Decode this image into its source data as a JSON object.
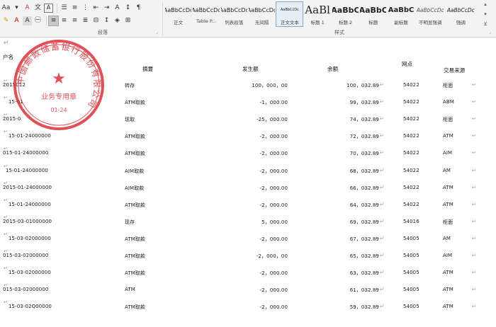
{
  "ribbon": {
    "paragraph_group_label": "段落",
    "styles_group_label": "样式",
    "styles": [
      {
        "preview": "AaBbCcDc",
        "name": "正文"
      },
      {
        "preview": "AaBbCcDc",
        "name": "Table P..."
      },
      {
        "preview": "AaBbCcDc",
        "name": "列表段落"
      },
      {
        "preview": "AaBbCcDc",
        "name": "无间隔"
      },
      {
        "preview": "AaBbCcDc",
        "name": "正文文本"
      },
      {
        "preview": "AaBl",
        "name": "标题 1"
      },
      {
        "preview": "AaBbC",
        "name": "标题 2"
      },
      {
        "preview": "AaBbC",
        "name": "标题"
      },
      {
        "preview": "AaBbC",
        "name": "副标题"
      },
      {
        "preview": "AaBbCcDc",
        "name": "不明显强调"
      },
      {
        "preview": "AaBbCcDc",
        "name": "强调"
      }
    ],
    "selected_style": "正文文本"
  },
  "seal": {
    "outer_text": "中国邮政储蓄银行股份有限公司",
    "inner_text": "业务专用章",
    "code": "01-24"
  },
  "table": {
    "header": {
      "account": "户名",
      "summary": "摘要",
      "amount": "发生额",
      "balance": "余额",
      "branch": "网点",
      "source": "交易来源"
    },
    "rows": [
      {
        "date": "2015012",
        "summary": "转存",
        "amount": "100，000，00",
        "balance": "100，032.89",
        "branch": "54022",
        "source": "柜面"
      },
      {
        "date": "15-01",
        "summary": "ATM取款",
        "amount": "-1，000.00",
        "balance": "99，032.89",
        "branch": "54022",
        "source": "ABM"
      },
      {
        "date": "2015-0",
        "summary": "现取",
        "amount": "-25，000.00",
        "balance": "74，032.89",
        "branch": "54022",
        "source": "柜面"
      },
      {
        "date": "15-01-24000000",
        "summary": "ATM取款",
        "amount": "-2，000.00",
        "balance": "72，032.89",
        "branch": "54022",
        "source": "ATM"
      },
      {
        "date": "015-01-24000000",
        "summary": "ATM取款",
        "amount": "-2，000.00",
        "balance": "70，032.89",
        "branch": "54022",
        "source": "AIM"
      },
      {
        "date": "15-01-24000000",
        "summary": "AIM取款",
        "amount": "-2，000.00",
        "balance": "68，032.89",
        "branch": "54022",
        "source": "AM"
      },
      {
        "date": "2015-01-24000000",
        "summary": "AIM取款",
        "amount": "-2，000.00",
        "balance": "66，032.89",
        "branch": "54022",
        "source": "ATM"
      },
      {
        "date": "15-01-24000000",
        "summary": "ATM取款",
        "amount": "-2，000.00",
        "balance": "64，032.89",
        "branch": "54022",
        "source": "ATM"
      },
      {
        "date": "2015-03-01000000",
        "summary": "现存",
        "amount": "5，000.00",
        "balance": "69，032.89",
        "branch": "54016",
        "source": "柜面"
      },
      {
        "date": "15-03-02000000",
        "summary": "ATM取款",
        "amount": "-2，000.00",
        "balance": "67，032.89",
        "branch": "54005",
        "source": "AM"
      },
      {
        "date": "015-03-02000000",
        "summary": "ATM取款",
        "amount": "-2，000，00",
        "balance": "65，032.89",
        "branch": "54005",
        "source": "AIM"
      },
      {
        "date": "15-03-02000000",
        "summary": "ATM取款",
        "amount": "-2，000.00",
        "balance": "63，032.89",
        "branch": "54005",
        "source": "ATM"
      },
      {
        "date": "015-03-02000000",
        "summary": "ATM",
        "amount": "-2，000.00",
        "balance": "61，032.89",
        "branch": "54005",
        "source": "ATM"
      },
      {
        "date": "15-03-02Q00000",
        "summary": "ATM取款",
        "amount": "-2，000.00",
        "balance": "59，032.89",
        "branch": "54005",
        "source": "ATM"
      }
    ]
  },
  "colors": {
    "seal_red": "#d8343c",
    "ribbon_bg": "#f3f3f3",
    "selected_style_border": "#8fa6c2"
  }
}
